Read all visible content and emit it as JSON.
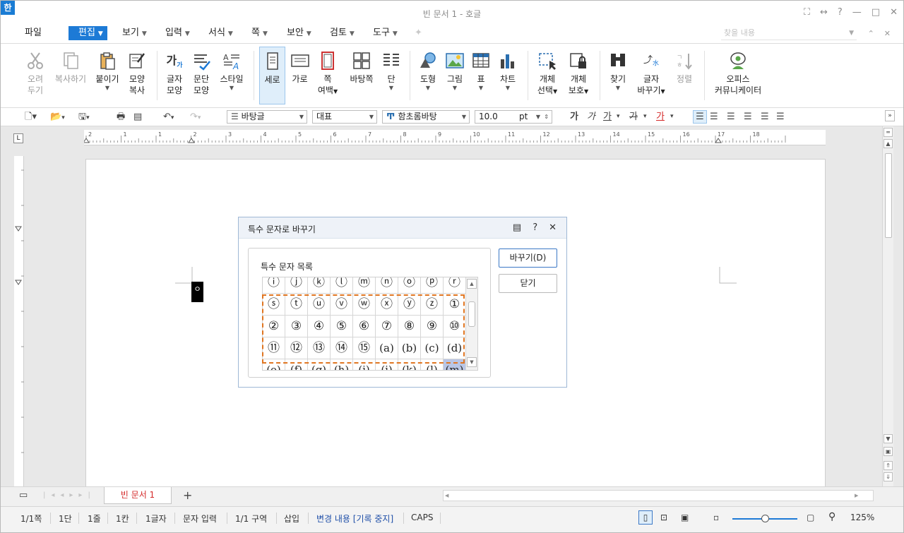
{
  "window": {
    "app_icon": "한",
    "title": "빈 문서 1 - 호글",
    "controls": [
      "⛶",
      "↔",
      "?",
      "—",
      "□",
      "✕"
    ]
  },
  "menubar": {
    "items": [
      {
        "label": "파일",
        "has_caret": false
      },
      {
        "label": "편집",
        "has_caret": true,
        "active": true
      },
      {
        "label": "보기",
        "has_caret": true
      },
      {
        "label": "입력",
        "has_caret": true
      },
      {
        "label": "서식",
        "has_caret": true
      },
      {
        "label": "쪽",
        "has_caret": true
      },
      {
        "label": "보안",
        "has_caret": true
      },
      {
        "label": "검토",
        "has_caret": true
      },
      {
        "label": "도구",
        "has_caret": true
      }
    ],
    "search_placeholder": "찾을 내용",
    "right_controls": [
      "⌃",
      "✕"
    ]
  },
  "ribbon": {
    "cut": [
      "오려",
      "두기"
    ],
    "copy": "복사하기",
    "paste": "붙이기",
    "format_copy": [
      "모양",
      "복사"
    ],
    "char_shape": [
      "글자",
      "모양"
    ],
    "para_shape": [
      "문단",
      "모양"
    ],
    "style": "스타일",
    "vertical": "세로",
    "horizontal": "가로",
    "page_margin": [
      "쪽",
      "여백"
    ],
    "background_page": "바탕쪽",
    "columns": "단",
    "shape": "도형",
    "image": "그림",
    "table": "표",
    "chart": "차트",
    "obj_select": [
      "개체",
      "선택"
    ],
    "obj_protect": [
      "개체",
      "보호"
    ],
    "find": "찾기",
    "char_replace": [
      "글자",
      "바꾸기"
    ],
    "sort": "정렬",
    "office_communicator": [
      "오피스",
      "커뮤니케이터"
    ]
  },
  "format_toolbar": {
    "style": "바탕글",
    "lang": "대표",
    "font": "함초롬바탕",
    "size": "10.0",
    "unit": "pt",
    "bold": "가",
    "italic": "가",
    "underline": "가",
    "strike": "가",
    "color": "가"
  },
  "ruler": {
    "labels": [
      "2",
      "1",
      "1",
      "2",
      "3",
      "4",
      "5",
      "6",
      "7",
      "8",
      "9",
      "10",
      "11",
      "12",
      "13",
      "14",
      "15",
      "16",
      "17",
      "18"
    ],
    "corner": "L"
  },
  "caret_char": "ㅇ",
  "dialog": {
    "title": "특수 문자로 바꾸기",
    "group_label": "특수 문자 목록",
    "rows": [
      [
        "ⓘ",
        "ⓙ",
        "ⓚ",
        "ⓛ",
        "ⓜ",
        "ⓝ",
        "ⓞ",
        "ⓟ",
        "ⓡ"
      ],
      [
        "ⓢ",
        "ⓣ",
        "ⓤ",
        "ⓥ",
        "ⓦ",
        "ⓧ",
        "ⓨ",
        "ⓩ",
        "①"
      ],
      [
        "②",
        "③",
        "④",
        "⑤",
        "⑥",
        "⑦",
        "⑧",
        "⑨",
        "⑩"
      ],
      [
        "⑪",
        "⑫",
        "⑬",
        "⑭",
        "⑮",
        "(a)",
        "(b)",
        "(c)",
        "(d)"
      ],
      [
        "(e)",
        "(f)",
        "(g)",
        "(h)",
        "(i)",
        "(j)",
        "(k)",
        "(l)",
        "(m)"
      ]
    ],
    "replace_button": "바꾸기(D)",
    "close_button": "닫기"
  },
  "tabs": {
    "doc_tab": "빈 문서 1",
    "add": "+"
  },
  "status": {
    "page": "1/1쪽",
    "column": "1단",
    "line": "1줄",
    "col": "1칸",
    "chars": "1글자",
    "mode": "문자 입력",
    "section": "1/1 구역",
    "insert": "삽입",
    "track": "변경 내용 [기록 중지]",
    "caps": "CAPS",
    "zoom": "125%"
  },
  "colors": {
    "accent": "#1d7ad6",
    "tab_text": "#d42a2a",
    "selection_dash": "#e07622",
    "track_text": "#1f4fa8"
  }
}
